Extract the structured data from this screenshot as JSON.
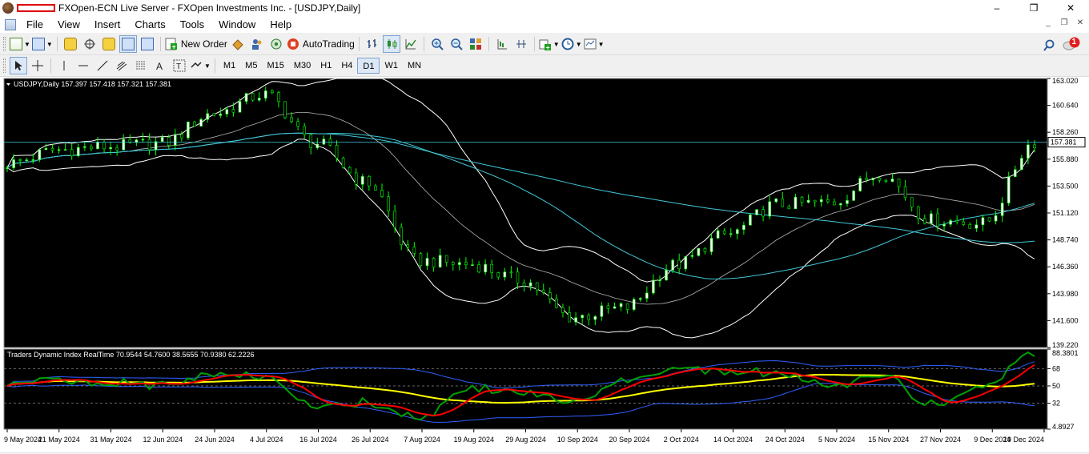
{
  "window": {
    "title": "FXOpen-ECN Live Server - FXOpen Investments Inc. - [USDJPY,Daily]",
    "buttons": {
      "minimize": "–",
      "maximize": "❐",
      "close": "✕"
    }
  },
  "menu": [
    "File",
    "View",
    "Insert",
    "Charts",
    "Tools",
    "Window",
    "Help"
  ],
  "toolbar": {
    "new_order": "New Order",
    "auto_trading": "AutoTrading"
  },
  "notifications": {
    "count": "1"
  },
  "timeframes": [
    "M1",
    "M5",
    "M15",
    "M30",
    "H1",
    "H4",
    "D1",
    "W1",
    "MN"
  ],
  "active_timeframe": "D1",
  "chart": {
    "header": "USDJPY,Daily  157.397 157.418 157.321 157.381",
    "indicator_header": "Traders Dynamic Index RealTime 70.9544 54.7600 38.5655 70.9380 62.2226",
    "current_price": "157.381",
    "price_axis": [
      "163.020",
      "160.640",
      "158.260",
      "155.880",
      "153.500",
      "151.120",
      "148.740",
      "146.360",
      "143.980",
      "141.600",
      "139.220"
    ],
    "indicator_axis": [
      "88.3801",
      "68",
      "50",
      "32",
      "4.8927"
    ],
    "date_axis": [
      "9 May 2024",
      "21 May 2024",
      "31 May 2024",
      "12 Jun 2024",
      "24 Jun 2024",
      "4 Jul 2024",
      "16 Jul 2024",
      "26 Jul 2024",
      "7 Aug 2024",
      "19 Aug 2024",
      "29 Aug 2024",
      "10 Sep 2024",
      "20 Sep 2024",
      "2 Oct 2024",
      "14 Oct 2024",
      "24 Oct 2024",
      "5 Nov 2024",
      "15 Nov 2024",
      "27 Nov 2024",
      "9 Dec 2024",
      "19 Dec 2024"
    ],
    "colors": {
      "background": "#000000",
      "bull_candle": "#ffffff",
      "bear_candle": "#000000",
      "candle_wick": "#00ff00",
      "bollinger": "#ffffff",
      "moving_average": "#40c8d8",
      "tdi_rsi": "#00a000",
      "tdi_signal": "#ff0000",
      "tdi_base": "#ffff00",
      "tdi_band": "#3060ff"
    }
  },
  "chart_data": {
    "type": "line",
    "xlabel": "",
    "ylabel": "",
    "x": [
      "9 May 2024",
      "21 May 2024",
      "31 May 2024",
      "12 Jun 2024",
      "24 Jun 2024",
      "4 Jul 2024",
      "16 Jul 2024",
      "26 Jul 2024",
      "7 Aug 2024",
      "19 Aug 2024",
      "29 Aug 2024",
      "10 Sep 2024",
      "20 Sep 2024",
      "2 Oct 2024",
      "14 Oct 2024",
      "24 Oct 2024",
      "5 Nov 2024",
      "15 Nov 2024",
      "27 Nov 2024",
      "9 Dec 2024",
      "19 Dec 2024"
    ],
    "ylim": [
      139.22,
      163.02
    ],
    "series": [
      {
        "name": "USDJPY,Daily",
        "values": [
          155.5,
          156.7,
          157.0,
          157.3,
          159.9,
          161.6,
          157.3,
          153.8,
          146.9,
          146.6,
          145.2,
          141.9,
          142.7,
          146.5,
          149.2,
          151.9,
          152.0,
          154.6,
          150.5,
          150.2,
          157.4
        ]
      }
    ],
    "indicator": {
      "name": "Traders Dynamic Index RealTime",
      "ylim": [
        4.8927,
        88.3801
      ],
      "levels": [
        68,
        50,
        32
      ]
    }
  }
}
